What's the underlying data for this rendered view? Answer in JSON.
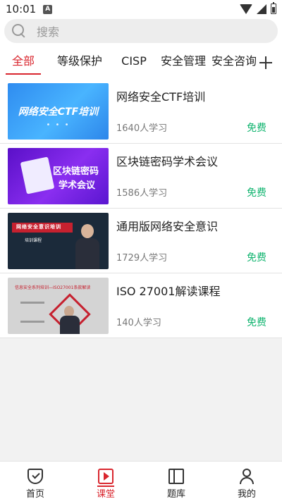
{
  "status_bar": {
    "time": "10:01",
    "notification_letter": "A"
  },
  "search": {
    "placeholder": "搜索"
  },
  "tabs": [
    {
      "label": "全部",
      "active": true
    },
    {
      "label": "等级保护"
    },
    {
      "label": "CISP"
    },
    {
      "label": "安全管理"
    },
    {
      "label": "安全咨询"
    }
  ],
  "courses": [
    {
      "title": "网络安全CTF培训",
      "learners": "1640人学习",
      "price": "免费",
      "thumb_text": "网络安全CTF培训",
      "thumb_dots": "• • •"
    },
    {
      "title": "区块链密码学术会议",
      "learners": "1586人学习",
      "price": "免费",
      "thumb_line1": "区块链密码",
      "thumb_line2": "学术会议"
    },
    {
      "title": "通用版网络安全意识",
      "learners": "1729人学习",
      "price": "免费",
      "thumb_band": "网络安全意识培训",
      "thumb_sub": "培训课程"
    },
    {
      "title": "ISO 27001解读课程",
      "learners": "140人学习",
      "price": "免费",
      "thumb_band": "信息安全系列培训—ISO27001条款解读"
    }
  ],
  "bottom_nav": [
    {
      "label": "首页",
      "icon": "shield-icon"
    },
    {
      "label": "课堂",
      "icon": "play-icon",
      "active": true
    },
    {
      "label": "题库",
      "icon": "book-icon"
    },
    {
      "label": "我的",
      "icon": "user-icon"
    }
  ],
  "colors": {
    "accent": "#d9262e",
    "free": "#10b46f"
  }
}
